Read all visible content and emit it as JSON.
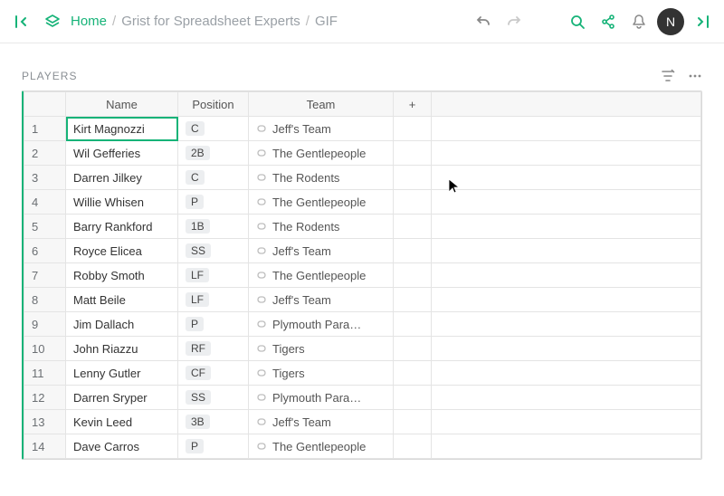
{
  "topbar": {
    "home_label": "Home",
    "crumb1": "Grist for Spreadsheet Experts",
    "crumb2": "GIF",
    "avatar_initial": "N"
  },
  "section": {
    "title": "PLAYERS"
  },
  "grid": {
    "headers": {
      "name": "Name",
      "position": "Position",
      "team": "Team",
      "add": "+"
    },
    "rows": [
      {
        "n": "1",
        "name": "Kirt Magnozzi",
        "pos": "C",
        "team": "Jeff's Team"
      },
      {
        "n": "2",
        "name": "Wil Gefferies",
        "pos": "2B",
        "team": "The Gentlepeople"
      },
      {
        "n": "3",
        "name": "Darren Jilkey",
        "pos": "C",
        "team": "The Rodents"
      },
      {
        "n": "4",
        "name": "Willie Whisen",
        "pos": "P",
        "team": "The Gentlepeople"
      },
      {
        "n": "5",
        "name": "Barry Rankford",
        "pos": "1B",
        "team": "The Rodents"
      },
      {
        "n": "6",
        "name": "Royce Elicea",
        "pos": "SS",
        "team": "Jeff's Team"
      },
      {
        "n": "7",
        "name": "Robby Smoth",
        "pos": "LF",
        "team": "The Gentlepeople"
      },
      {
        "n": "8",
        "name": "Matt Beile",
        "pos": "LF",
        "team": "Jeff's Team"
      },
      {
        "n": "9",
        "name": "Jim Dallach",
        "pos": "P",
        "team": "Plymouth Para…"
      },
      {
        "n": "10",
        "name": "John Riazzu",
        "pos": "RF",
        "team": "Tigers"
      },
      {
        "n": "11",
        "name": "Lenny Gutler",
        "pos": "CF",
        "team": "Tigers"
      },
      {
        "n": "12",
        "name": "Darren Sryper",
        "pos": "SS",
        "team": "Plymouth Para…"
      },
      {
        "n": "13",
        "name": "Kevin Leed",
        "pos": "3B",
        "team": "Jeff's Team"
      },
      {
        "n": "14",
        "name": "Dave Carros",
        "pos": "P",
        "team": "The Gentlepeople"
      }
    ],
    "selected_row_index": 0
  }
}
